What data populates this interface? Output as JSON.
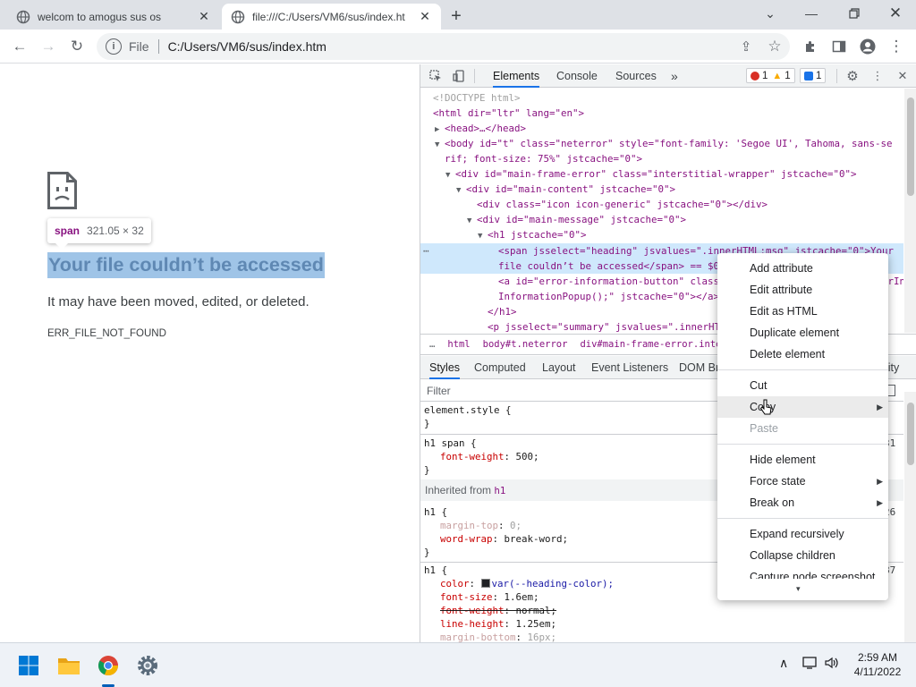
{
  "tabs": [
    {
      "title": "welcom to amogus sus os",
      "active": false
    },
    {
      "title": "file:///C:/Users/VM6/sus/index.ht",
      "active": true
    }
  ],
  "address": {
    "scheme": "File",
    "url": "C:/Users/VM6/sus/index.htm"
  },
  "page": {
    "tooltip_tag": "span",
    "tooltip_dims": "321.05 × 32",
    "heading": "Your file couldn’t be accessed",
    "subtext": "It may have been moved, edited, or deleted.",
    "error_code": "ERR_FILE_NOT_FOUND"
  },
  "devtools": {
    "tabs": [
      "Elements",
      "Console",
      "Sources"
    ],
    "more_tabs": "»",
    "errors": "1",
    "warnings": "1",
    "messages": "1",
    "dom": {
      "doctype": "<!DOCTYPE html>",
      "html_open": "<html dir=\"ltr\" lang=\"en\">",
      "head": "<head>…</head>",
      "body_open_1": "<body id=\"t\" class=\"neterror\" style=\"font-family: 'Segoe UI', Tahoma, sans-se",
      "body_open_2": "rif; font-size: 75%\" jstcache=\"0\">",
      "main_frame": "<div id=\"main-frame-error\" class=\"interstitial-wrapper\" jstcache=\"0\">",
      "main_content": "<div id=\"main-content\" jstcache=\"0\">",
      "icon_div": "<div class=\"icon icon-generic\" jstcache=\"0\"></div>",
      "main_message": "<div id=\"main-message\" jstcache=\"0\">",
      "h1_open": "<h1 jstcache=\"0\">",
      "span_line_1": "<span jsselect=\"heading\" jsvalues=\".innerHTML:msg\" jstcache=\"0\">Your",
      "span_line_2": "file couldn’t be accessed</span> == $0",
      "a_line_1": "<a id=\"error-information-button\" class=\"hidden\" onclick=\"toggleErrorInfor",
      "a_line_2": "InformationPopup();\" jstcache=\"0\"></a>",
      "h1_close": "</h1>",
      "p_line": "<p jsselect=\"summary\" jsvalues=\".innerHTML:msg\" jstcache=\"0\">"
    },
    "breadcrumbs": [
      "…",
      "html",
      "body#t.neterror",
      "div#main-frame-error.interstiti"
    ],
    "style_tabs": [
      "Styles",
      "Computed",
      "Layout",
      "Event Listeners",
      "DOM Br",
      "lity"
    ],
    "filter_placeholder": "Filter",
    "styles": {
      "element_style": "element.style {",
      "close": "}",
      "h1_span_sel": "h1 span {",
      "font_weight_prop": "font-weight",
      "font_weight_val": "500;",
      "inherited_label": "Inherited from",
      "inherited_tag": "h1",
      "h1_sel": "h1 {",
      "margin_top_prop": "margin-top",
      "margin_top_val": "0;",
      "word_wrap_prop": "word-wrap",
      "word_wrap_val": "break-word;",
      "color_prop": "color",
      "color_val": "var(--heading-color);",
      "font_size_prop": "font-size",
      "font_size_val": "1.6em;",
      "font_weight2_prop": "font-weight",
      "font_weight2_val": "normal;",
      "line_height_prop": "line-height",
      "line_height_val": "1.25em;",
      "margin_bottom_prop": "margin-bottom",
      "margin_bottom_val": "16px;",
      "ref1": "31",
      "ref2": "26",
      "ref3": "87"
    }
  },
  "context_menu": {
    "items_group1": [
      "Add attribute",
      "Edit attribute",
      "Edit as HTML",
      "Duplicate element",
      "Delete element"
    ],
    "cut": "Cut",
    "copy": "Copy",
    "paste": "Paste",
    "items_group3": [
      "Hide element",
      "Force state",
      "Break on"
    ],
    "items_group4": [
      "Expand recursively",
      "Collapse children",
      "Capture node screenshot"
    ],
    "more_arrow": "▾"
  },
  "taskbar": {
    "time": "2:59 AM",
    "date": "4/11/2022"
  },
  "colors": {
    "accent": "#1a73e8",
    "selection": "#9fc4e7",
    "dom_selected": "#cfe8fc"
  }
}
